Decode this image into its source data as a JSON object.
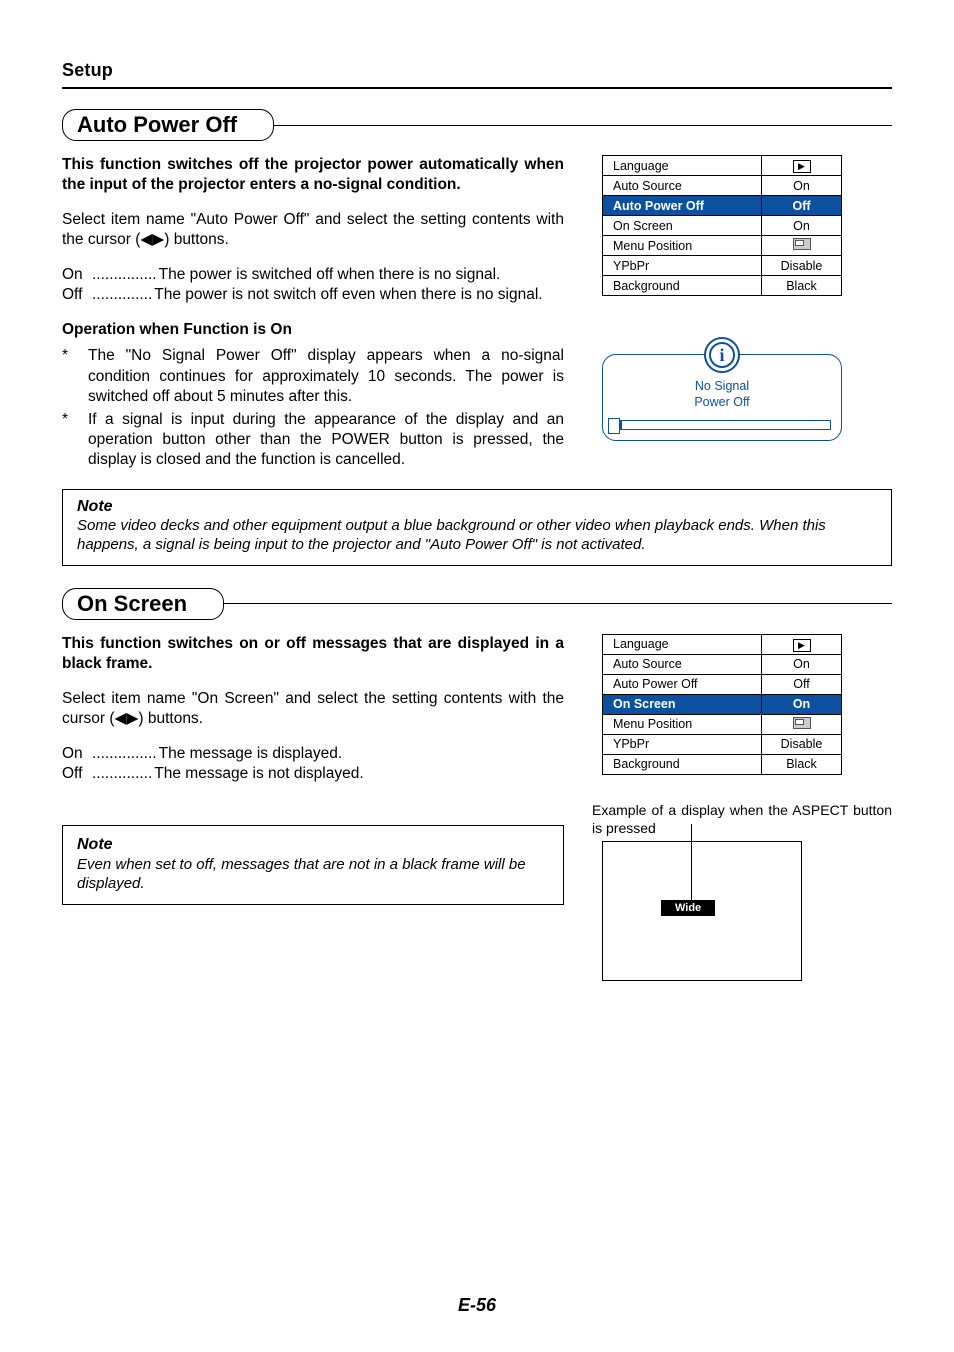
{
  "header": {
    "section": "Setup"
  },
  "autoPowerOff": {
    "title": "Auto Power Off",
    "intro": "This function switches off the projector power automatically when the input of the projector enters a no-signal condition.",
    "select": "Select item name \"Auto Power Off\" and select the setting contents with the cursor (◀▶) buttons.",
    "defs": {
      "on": {
        "key": "On",
        "dots": "...............",
        "val": "The power is switched off when there is no signal."
      },
      "off": {
        "key": "Off",
        "dots": "..............",
        "val": "The power is not switch off even when there is no signal."
      }
    },
    "opHeading": "Operation when Function is On",
    "bullets": [
      "The \"No Signal Power Off\" display appears when a no-signal condition continues for approximately 10 seconds. The power is switched off about 5 minutes after this.",
      "If a signal is input during the appearance of the display and an operation button other than the POWER button is pressed, the display is closed and the function is cancelled."
    ],
    "note": {
      "title": "Note",
      "text": "Some video decks and other equipment output a blue background or other video when playback ends. When this happens, a signal is being input to the projector and \"Auto Power Off\" is not activated."
    },
    "table": [
      {
        "label": "Language",
        "value": "play-icon",
        "selected": false
      },
      {
        "label": "Auto Source",
        "value": "On",
        "selected": false
      },
      {
        "label": "Auto Power Off",
        "value": "Off",
        "selected": true
      },
      {
        "label": "On Screen",
        "value": "On",
        "selected": false
      },
      {
        "label": "Menu Position",
        "value": "pos-icon",
        "selected": false
      },
      {
        "label": "YPbPr",
        "value": "Disable",
        "selected": false
      },
      {
        "label": "Background",
        "value": "Black",
        "selected": false
      }
    ],
    "infoDisplay": {
      "line1": "No Signal",
      "line2": "Power Off"
    }
  },
  "onScreen": {
    "title": "On Screen",
    "intro": "This function switches on or off messages that are displayed in a black frame.",
    "select": "Select item name \"On Screen\" and select the setting contents with the cursor (◀▶) buttons.",
    "defs": {
      "on": {
        "key": "On",
        "dots": "...............",
        "val": "The message is displayed."
      },
      "off": {
        "key": "Off",
        "dots": "..............",
        "val": "The message is not displayed."
      }
    },
    "note": {
      "title": "Note",
      "text": "Even when set to off, messages that are not in a black frame will be displayed."
    },
    "table": [
      {
        "label": "Language",
        "value": "play-icon",
        "selected": false
      },
      {
        "label": "Auto Source",
        "value": "On",
        "selected": false
      },
      {
        "label": "Auto Power Off",
        "value": "Off",
        "selected": false
      },
      {
        "label": "On Screen",
        "value": "On",
        "selected": true
      },
      {
        "label": "Menu Position",
        "value": "pos-icon",
        "selected": false
      },
      {
        "label": "YPbPr",
        "value": "Disable",
        "selected": false
      },
      {
        "label": "Background",
        "value": "Black",
        "selected": false
      }
    ],
    "caption": "Example of a display when the ASPECT button is pressed",
    "aspectLabel": "Wide"
  },
  "footer": {
    "pageNumber": "E-56"
  }
}
